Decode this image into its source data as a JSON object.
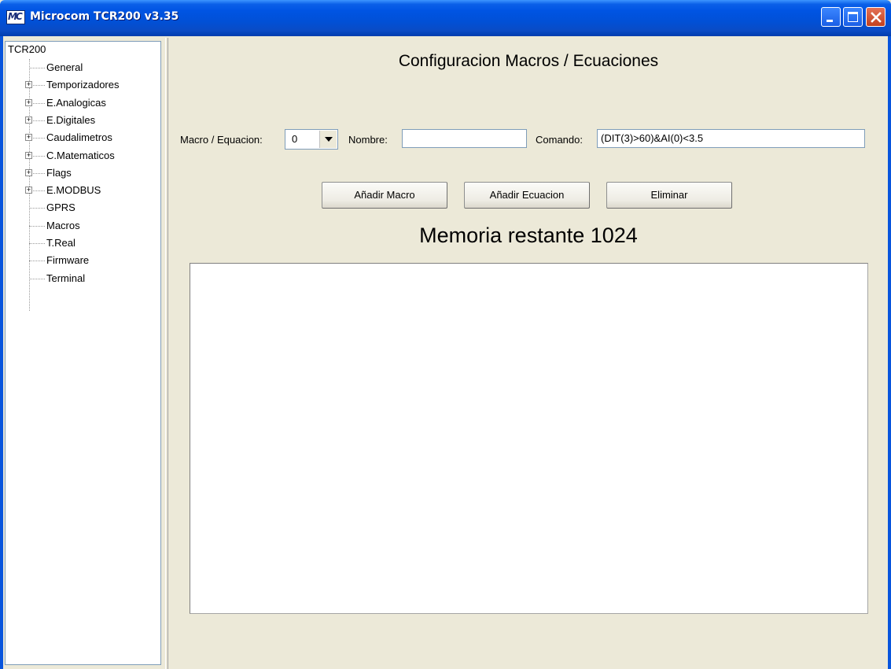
{
  "window": {
    "title": "Microcom TCR200 v3.35",
    "icon_text": "MC"
  },
  "tree": {
    "root": "TCR200",
    "items": [
      {
        "label": "General",
        "expandable": false
      },
      {
        "label": "Temporizadores",
        "expandable": true
      },
      {
        "label": "E.Analogicas",
        "expandable": true
      },
      {
        "label": "E.Digitales",
        "expandable": true
      },
      {
        "label": "Caudalimetros",
        "expandable": true
      },
      {
        "label": "C.Matematicos",
        "expandable": true
      },
      {
        "label": "Flags",
        "expandable": true
      },
      {
        "label": "E.MODBUS",
        "expandable": true
      },
      {
        "label": "GPRS",
        "expandable": false
      },
      {
        "label": "Macros",
        "expandable": false
      },
      {
        "label": "T.Real",
        "expandable": false
      },
      {
        "label": "Firmware",
        "expandable": false
      },
      {
        "label": "Terminal",
        "expandable": false
      }
    ]
  },
  "main": {
    "heading": "Configuracion Macros / Ecuaciones",
    "macro_label": "Macro / Equacion:",
    "macro_value": "0",
    "nombre_label": "Nombre:",
    "nombre_value": "",
    "comando_label": "Comando:",
    "comando_value": "(DIT(3)>60)&AI(0)<3.5",
    "buttons": {
      "add_macro": "Añadir Macro",
      "add_equation": "Añadir Ecuacion",
      "delete": "Eliminar"
    },
    "memory_text": "Memoria restante 1024"
  },
  "colors": {
    "titlebar": "#0054e3",
    "window_bg": "#ece9d8",
    "close_button": "#c2411f"
  }
}
